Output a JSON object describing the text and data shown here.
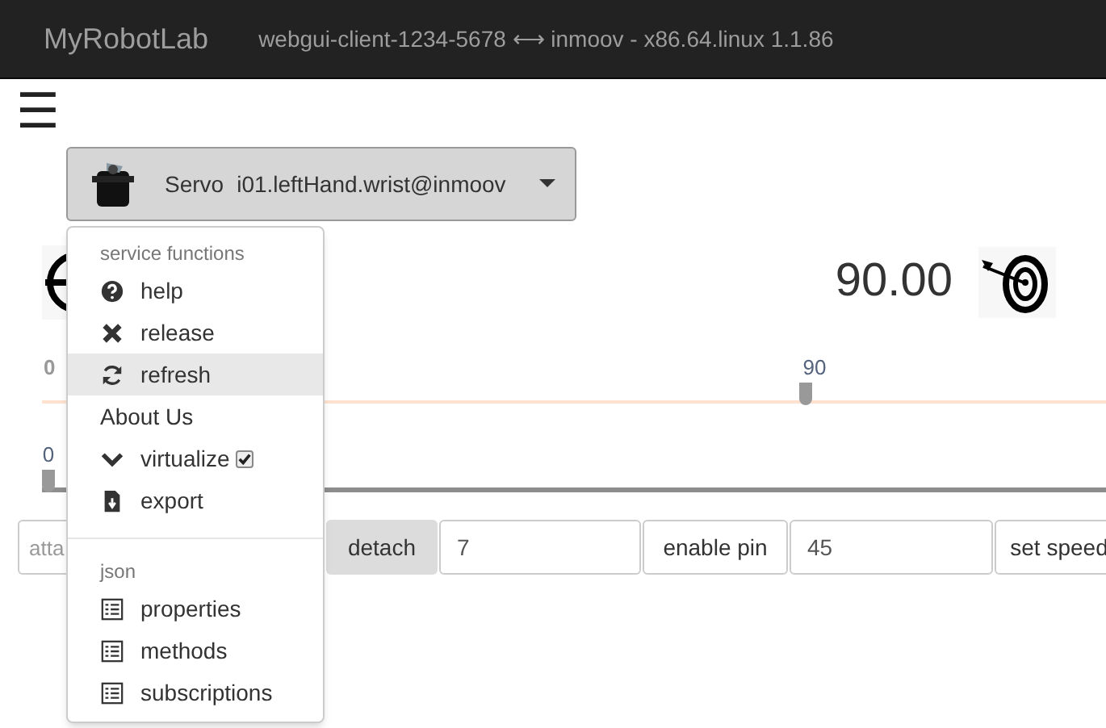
{
  "navbar": {
    "brand": "MyRobotLab",
    "connection": "webgui-client-1234-5678 ⟷ inmoov - x86.64.linux 1.1.86"
  },
  "menu_toggle": "☰",
  "service": {
    "type": "Servo",
    "name": "i01.leftHand.wrist@inmoov"
  },
  "position": {
    "value": "90.00"
  },
  "sliders": [
    {
      "kind": "setpoint",
      "min_label": "0",
      "value_label": "90",
      "level": 0.72
    },
    {
      "kind": "position",
      "value_label": "0",
      "level": 0
    }
  ],
  "controls": [
    {
      "kind": "input",
      "placeholder": "atta"
    },
    {
      "kind": "button",
      "label": "detach",
      "active": true
    },
    {
      "kind": "input",
      "value": "7"
    },
    {
      "kind": "button",
      "label": "enable pin",
      "active": false
    },
    {
      "kind": "input",
      "value": "45"
    },
    {
      "kind": "button",
      "label": "set speed",
      "active": false
    }
  ],
  "dropdown_menu": [
    {
      "kind": "header",
      "label": "service functions"
    },
    {
      "kind": "item",
      "label": "help",
      "highlighted": false
    },
    {
      "kind": "item",
      "label": "release",
      "highlighted": false
    },
    {
      "kind": "item",
      "label": "refresh",
      "highlighted": true
    },
    {
      "kind": "plain",
      "label": "About Us",
      "highlighted": false
    },
    {
      "kind": "toggle",
      "label": "virtualize",
      "checked": true,
      "highlighted": false
    },
    {
      "kind": "item",
      "label": "export",
      "highlighted": false
    },
    {
      "kind": "divider"
    },
    {
      "kind": "header",
      "label": "json"
    },
    {
      "kind": "item",
      "label": "properties",
      "highlighted": false
    },
    {
      "kind": "item",
      "label": "methods",
      "highlighted": false
    },
    {
      "kind": "item",
      "label": "subscriptions",
      "highlighted": false
    }
  ]
}
